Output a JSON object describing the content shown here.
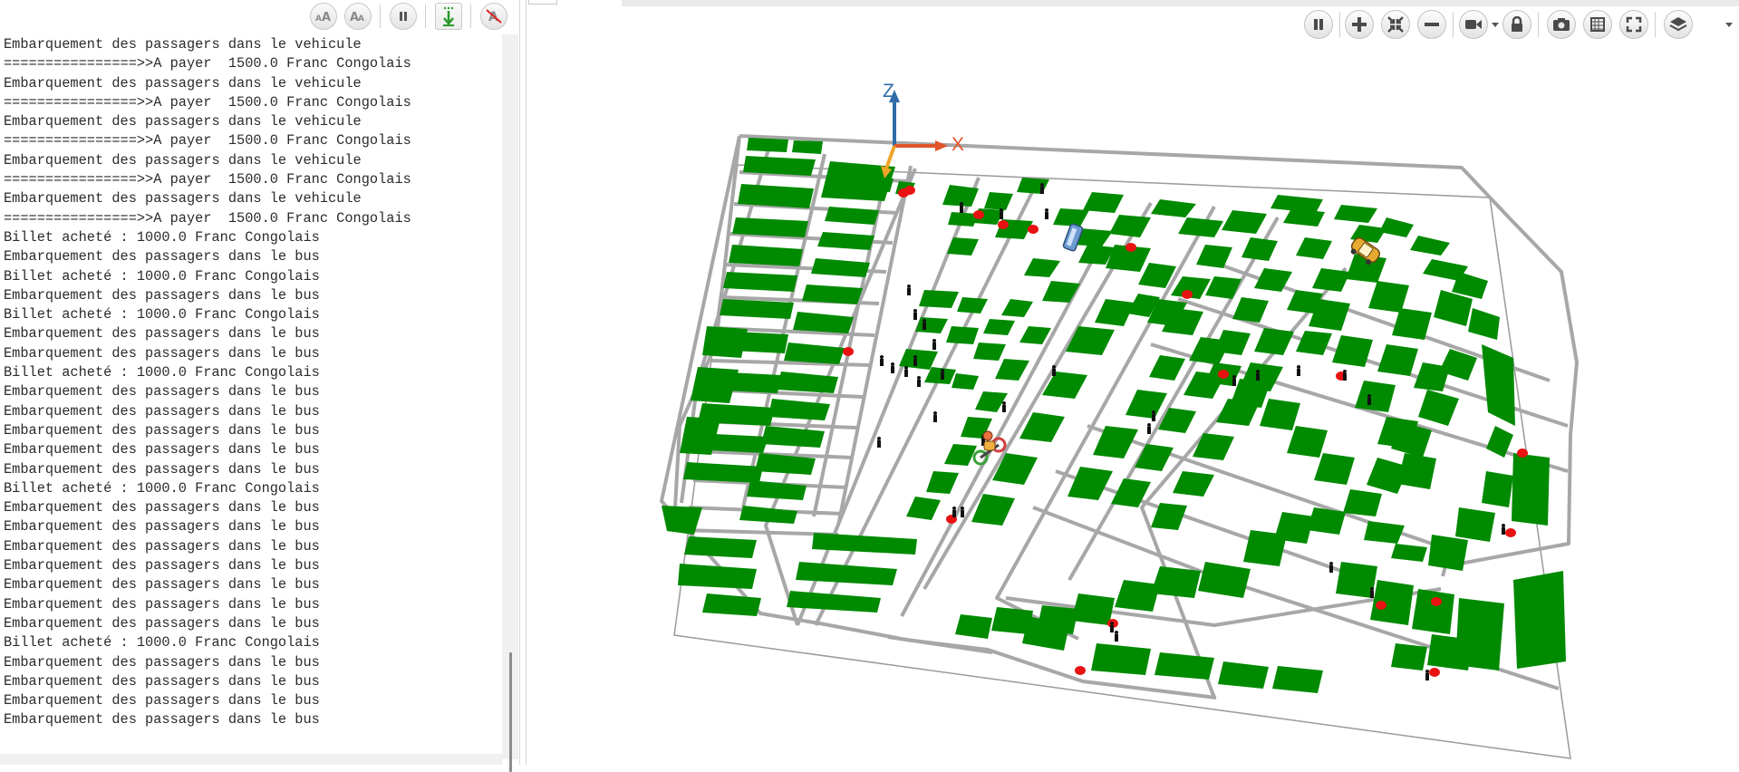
{
  "console": {
    "toolbar": {
      "icons": [
        "increase-font-icon",
        "decrease-font-icon",
        "pause-icon",
        "scroll-lock-icon",
        "clear-console-icon"
      ]
    },
    "lines": [
      "Embarquement des passagers dans le vehicule",
      "================>>A payer  1500.0 Franc Congolais",
      "Embarquement des passagers dans le vehicule",
      "================>>A payer  1500.0 Franc Congolais",
      "Embarquement des passagers dans le vehicule",
      "================>>A payer  1500.0 Franc Congolais",
      "Embarquement des passagers dans le vehicule",
      "================>>A payer  1500.0 Franc Congolais",
      "Embarquement des passagers dans le vehicule",
      "================>>A payer  1500.0 Franc Congolais",
      "Billet acheté : 1000.0 Franc Congolais",
      "Embarquement des passagers dans le bus",
      "Billet acheté : 1000.0 Franc Congolais",
      "Embarquement des passagers dans le bus",
      "Billet acheté : 1000.0 Franc Congolais",
      "Embarquement des passagers dans le bus",
      "Embarquement des passagers dans le bus",
      "Billet acheté : 1000.0 Franc Congolais",
      "Embarquement des passagers dans le bus",
      "Embarquement des passagers dans le bus",
      "Embarquement des passagers dans le bus",
      "Embarquement des passagers dans le bus",
      "Embarquement des passagers dans le bus",
      "Billet acheté : 1000.0 Franc Congolais",
      "Embarquement des passagers dans le bus",
      "Embarquement des passagers dans le bus",
      "Embarquement des passagers dans le bus",
      "Embarquement des passagers dans le bus",
      "Embarquement des passagers dans le bus",
      "Embarquement des passagers dans le bus",
      "Embarquement des passagers dans le bus",
      "Billet acheté : 1000.0 Franc Congolais",
      "Embarquement des passagers dans le bus",
      "Embarquement des passagers dans le bus",
      "Embarquement des passagers dans le bus",
      "Embarquement des passagers dans le bus"
    ]
  },
  "display": {
    "toolbar": {
      "icons": [
        "pause-icon",
        "zoom-in-icon",
        "zoom-fit-icon",
        "zoom-out-icon",
        "camera-icon",
        "lock-icon",
        "snapshot-icon",
        "toggle-3d-icon",
        "fullscreen-icon",
        "layers-icon"
      ]
    },
    "axes": {
      "x_label": "X",
      "z_label": "Z",
      "x_color": "#e0532a",
      "z_color": "#2f6ca8",
      "y_color": "#f0a428"
    },
    "colors": {
      "building": "#008a00",
      "road": "#a7a7a7",
      "background": "#ffffff",
      "agent": "#111111",
      "bus_stop": "#e81212"
    }
  }
}
